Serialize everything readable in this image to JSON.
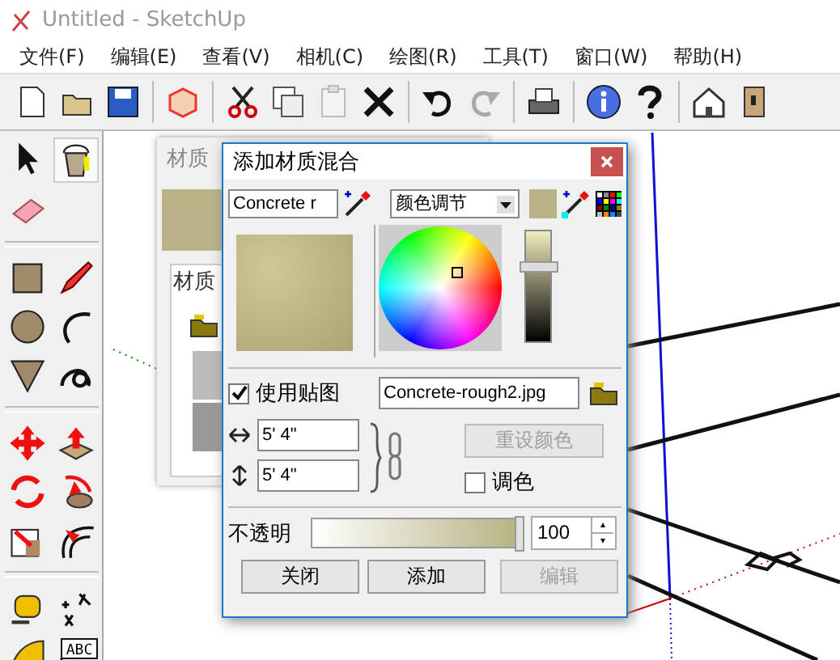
{
  "window": {
    "title": "Untitled - SketchUp"
  },
  "menu": [
    "文件(F)",
    "编辑(E)",
    "查看(V)",
    "相机(C)",
    "绘图(R)",
    "工具(T)",
    "窗口(W)",
    "帮助(H)"
  ],
  "tools": {
    "text_tool_label": "ABC"
  },
  "materials_panel": {
    "title": "材质",
    "tab": "材质"
  },
  "dialog": {
    "title": "添加材质混合",
    "name_value": "Concrete r",
    "mode_value": "颜色调节",
    "brightness": {
      "level": 0.67
    },
    "use_texture": {
      "label": "使用贴图",
      "checked": true
    },
    "texture_file": "Concrete-rough2.jpg",
    "width_value": "5' 4\"",
    "height_value": "5' 4\"",
    "reset_button": {
      "label": "重设颜色",
      "disabled": true
    },
    "colorize": {
      "label": "调色",
      "checked": false
    },
    "opacity": {
      "label": "不透明",
      "level": 1,
      "value": "100"
    },
    "buttons": [
      {
        "label": "关闭",
        "disabled": false
      },
      {
        "label": "添加",
        "disabled": false
      },
      {
        "label": "编辑",
        "disabled": true
      }
    ]
  }
}
